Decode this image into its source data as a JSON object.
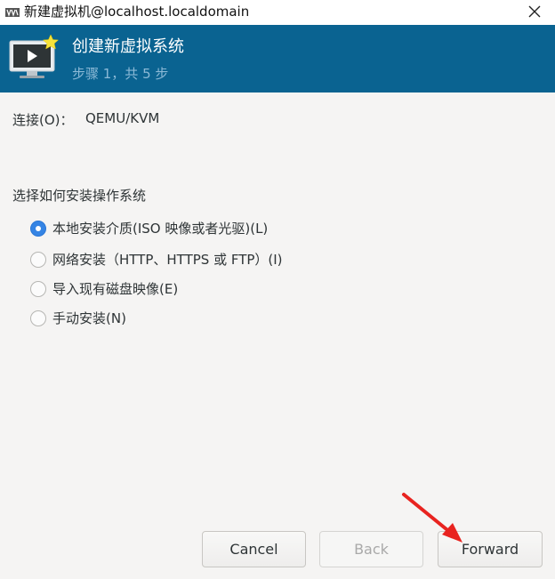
{
  "window": {
    "title": "新建虚拟机@localhost.localdomain",
    "app_icon": "virt-manager-icon",
    "close_icon": "close-icon"
  },
  "banner": {
    "title": "创建新虚拟系统",
    "step": "步骤 1，共 5 步",
    "icon": "monitor-play-star-icon"
  },
  "connection": {
    "label": "连接(O)：",
    "value": "QEMU/KVM"
  },
  "install_method": {
    "label": "选择如何安装操作系统",
    "selected": "local",
    "options": [
      {
        "id": "local",
        "label": "本地安装介质(ISO 映像或者光驱)(L)",
        "checked": true
      },
      {
        "id": "network",
        "label": "网络安装（HTTP、HTTPS 或 FTP）(I)",
        "checked": false
      },
      {
        "id": "import",
        "label": "导入现有磁盘映像(E)",
        "checked": false
      },
      {
        "id": "manual",
        "label": "手动安装(N)",
        "checked": false
      }
    ]
  },
  "buttons": {
    "cancel": "Cancel",
    "back": "Back",
    "forward": "Forward"
  },
  "colors": {
    "banner": "#0a6391",
    "accent": "#3584e4",
    "annotation_arrow": "#e8231f"
  }
}
